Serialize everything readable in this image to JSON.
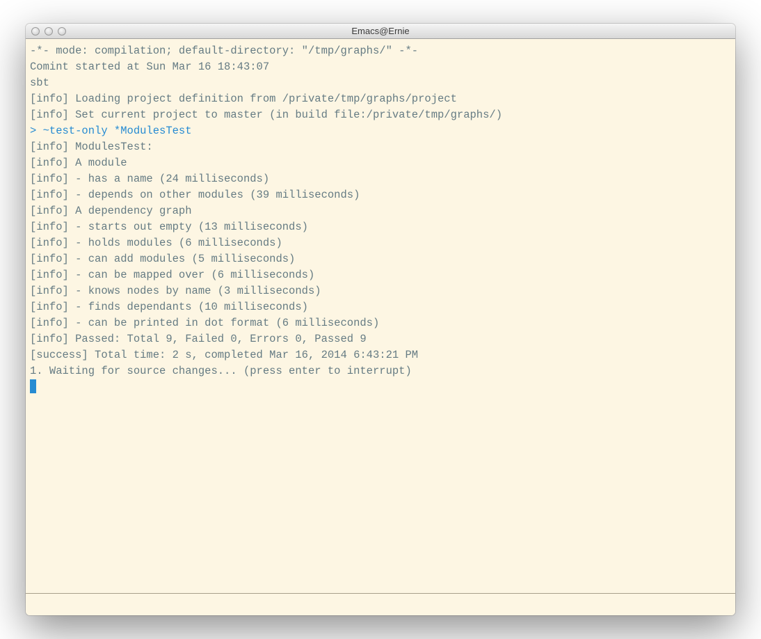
{
  "window": {
    "title": "Emacs@Ernie"
  },
  "lines": {
    "l0": "-*- mode: compilation; default-directory: \"/tmp/graphs/\" -*-",
    "l1": "Comint started at Sun Mar 16 18:43:07",
    "l2": "",
    "l3": "sbt",
    "l4": "[info] Loading project definition from /private/tmp/graphs/project",
    "l5": "[info] Set current project to master (in build file:/private/tmp/graphs/)",
    "l6_prompt": "> ~test-only *ModulesTest",
    "l7": "[info] ModulesTest:",
    "l8": "[info] A module",
    "l9": "[info] - has a name (24 milliseconds)",
    "l10": "[info] - depends on other modules (39 milliseconds)",
    "l11": "[info] A dependency graph",
    "l12": "[info] - starts out empty (13 milliseconds)",
    "l13": "[info] - holds modules (6 milliseconds)",
    "l14": "[info] - can add modules (5 milliseconds)",
    "l15": "[info] - can be mapped over (6 milliseconds)",
    "l16": "[info] - knows nodes by name (3 milliseconds)",
    "l17": "[info] - finds dependants (10 milliseconds)",
    "l18": "[info] - can be printed in dot format (6 milliseconds)",
    "l19": "[info] Passed: Total 9, Failed 0, Errors 0, Passed 9",
    "l20": "[success] Total time: 2 s, completed Mar 16, 2014 6:43:21 PM",
    "l21": "1. Waiting for source changes... (press enter to interrupt)"
  }
}
